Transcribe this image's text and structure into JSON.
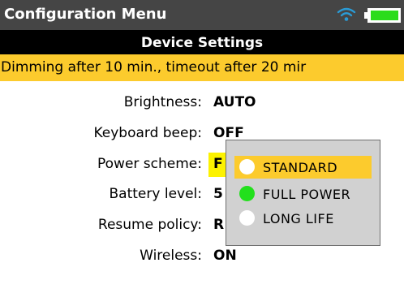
{
  "titlebar": {
    "title": "Configuration Menu",
    "wifi_icon": "wifi-icon",
    "battery_icon": "battery-icon",
    "battery_color": "#2bdc1c"
  },
  "subtitle": "Device Settings",
  "status": "Dimming after 10 min., timeout after 20 mir",
  "settings": [
    {
      "label": "Brightness:",
      "value": "AUTO"
    },
    {
      "label": "Keyboard beep:",
      "value": "OFF"
    },
    {
      "label": "Power scheme:",
      "value": "F"
    },
    {
      "label": "Battery level:",
      "value": "5"
    },
    {
      "label": "Resume policy:",
      "value": "R"
    },
    {
      "label": "Wireless:",
      "value": "ON"
    }
  ],
  "popup": {
    "options": [
      {
        "label": "STANDARD",
        "dot_color": "#ffffff",
        "selected": true
      },
      {
        "label": "FULL POWER",
        "dot_color": "#22e01c",
        "selected": false
      },
      {
        "label": "LONG LIFE",
        "dot_color": "#ffffff",
        "selected": false
      }
    ]
  },
  "colors": {
    "accent": "#fccb2d",
    "highlight": "#fcf200",
    "titlebar": "#454545",
    "subtitlebar": "#000000"
  }
}
